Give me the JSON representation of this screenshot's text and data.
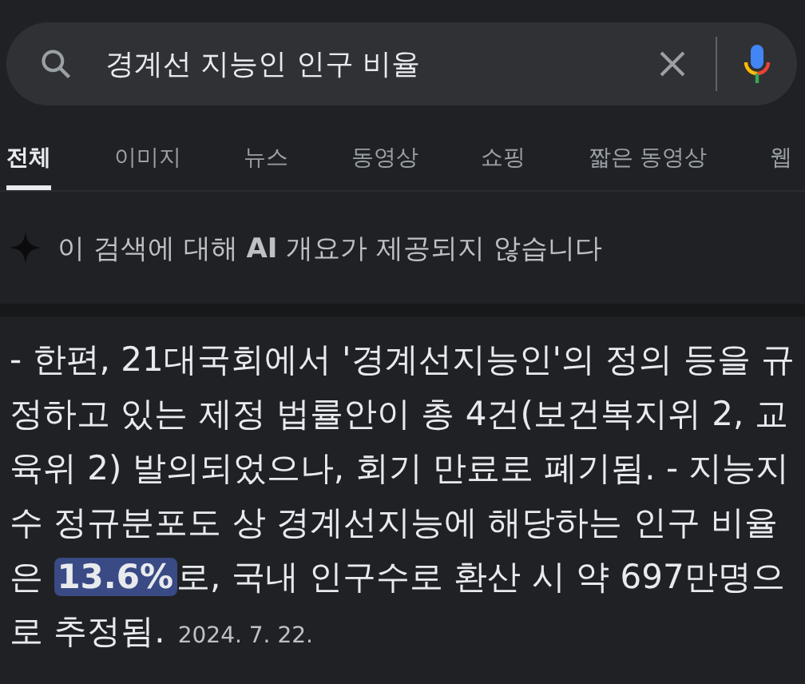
{
  "search": {
    "value": "경계선 지능인 인구 비율"
  },
  "tabs": [
    {
      "label": "전체",
      "selected": true
    },
    {
      "label": "이미지",
      "selected": false
    },
    {
      "label": "뉴스",
      "selected": false
    },
    {
      "label": "동영상",
      "selected": false
    },
    {
      "label": "쇼핑",
      "selected": false
    },
    {
      "label": "짧은 동영상",
      "selected": false
    },
    {
      "label": "웹",
      "selected": false
    }
  ],
  "ai_notice": "이 검색에 대해 **AI** 개요가 제공되지 않습니다",
  "snippet": {
    "text_before": "- 한편, 21대국회에서 '경계선지능인'의 정의 등을 규정하고 있는 제정 법률안이 총 4건(보건복지위 2, 교육위 2) 발의되었으나, 회기 만료로 폐기됨. - 지능지수 정규분포도 상 경계선지능에 해당하는 인구 비율은 ",
    "highlight": "13.6%",
    "text_after": "로, 국내 인구수로 환산 시 약 697만명으로 추정됨.",
    "date": "2024. 7. 22."
  }
}
